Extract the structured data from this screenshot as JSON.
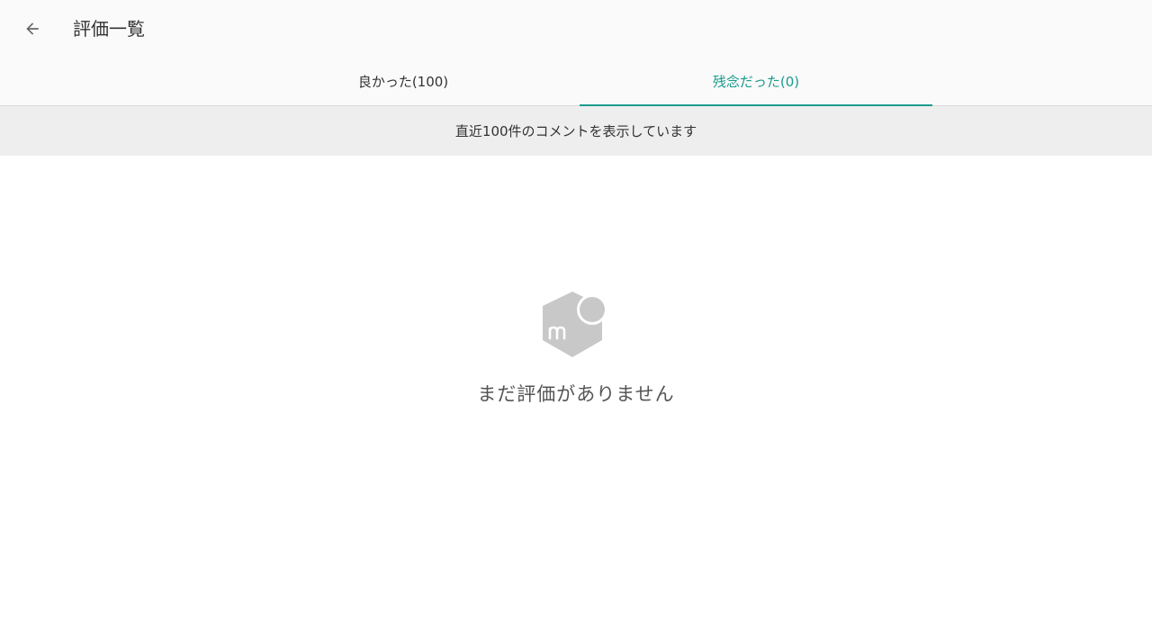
{
  "header": {
    "back_icon": "arrow-left-icon",
    "title": "評価一覧"
  },
  "tabs": [
    {
      "label": "良かった(100)",
      "selected": false
    },
    {
      "label": "残念だった(0)",
      "selected": true
    }
  ],
  "notice": {
    "text": "直近100件のコメントを表示しています"
  },
  "empty_state": {
    "icon": "mercari-logo-icon",
    "message": "まだ評価がありません"
  },
  "colors": {
    "accent": "#1a9a8e",
    "header_bg": "#fafafa",
    "notice_bg": "#eeeeee",
    "logo_gray": "#c8c8c8"
  }
}
